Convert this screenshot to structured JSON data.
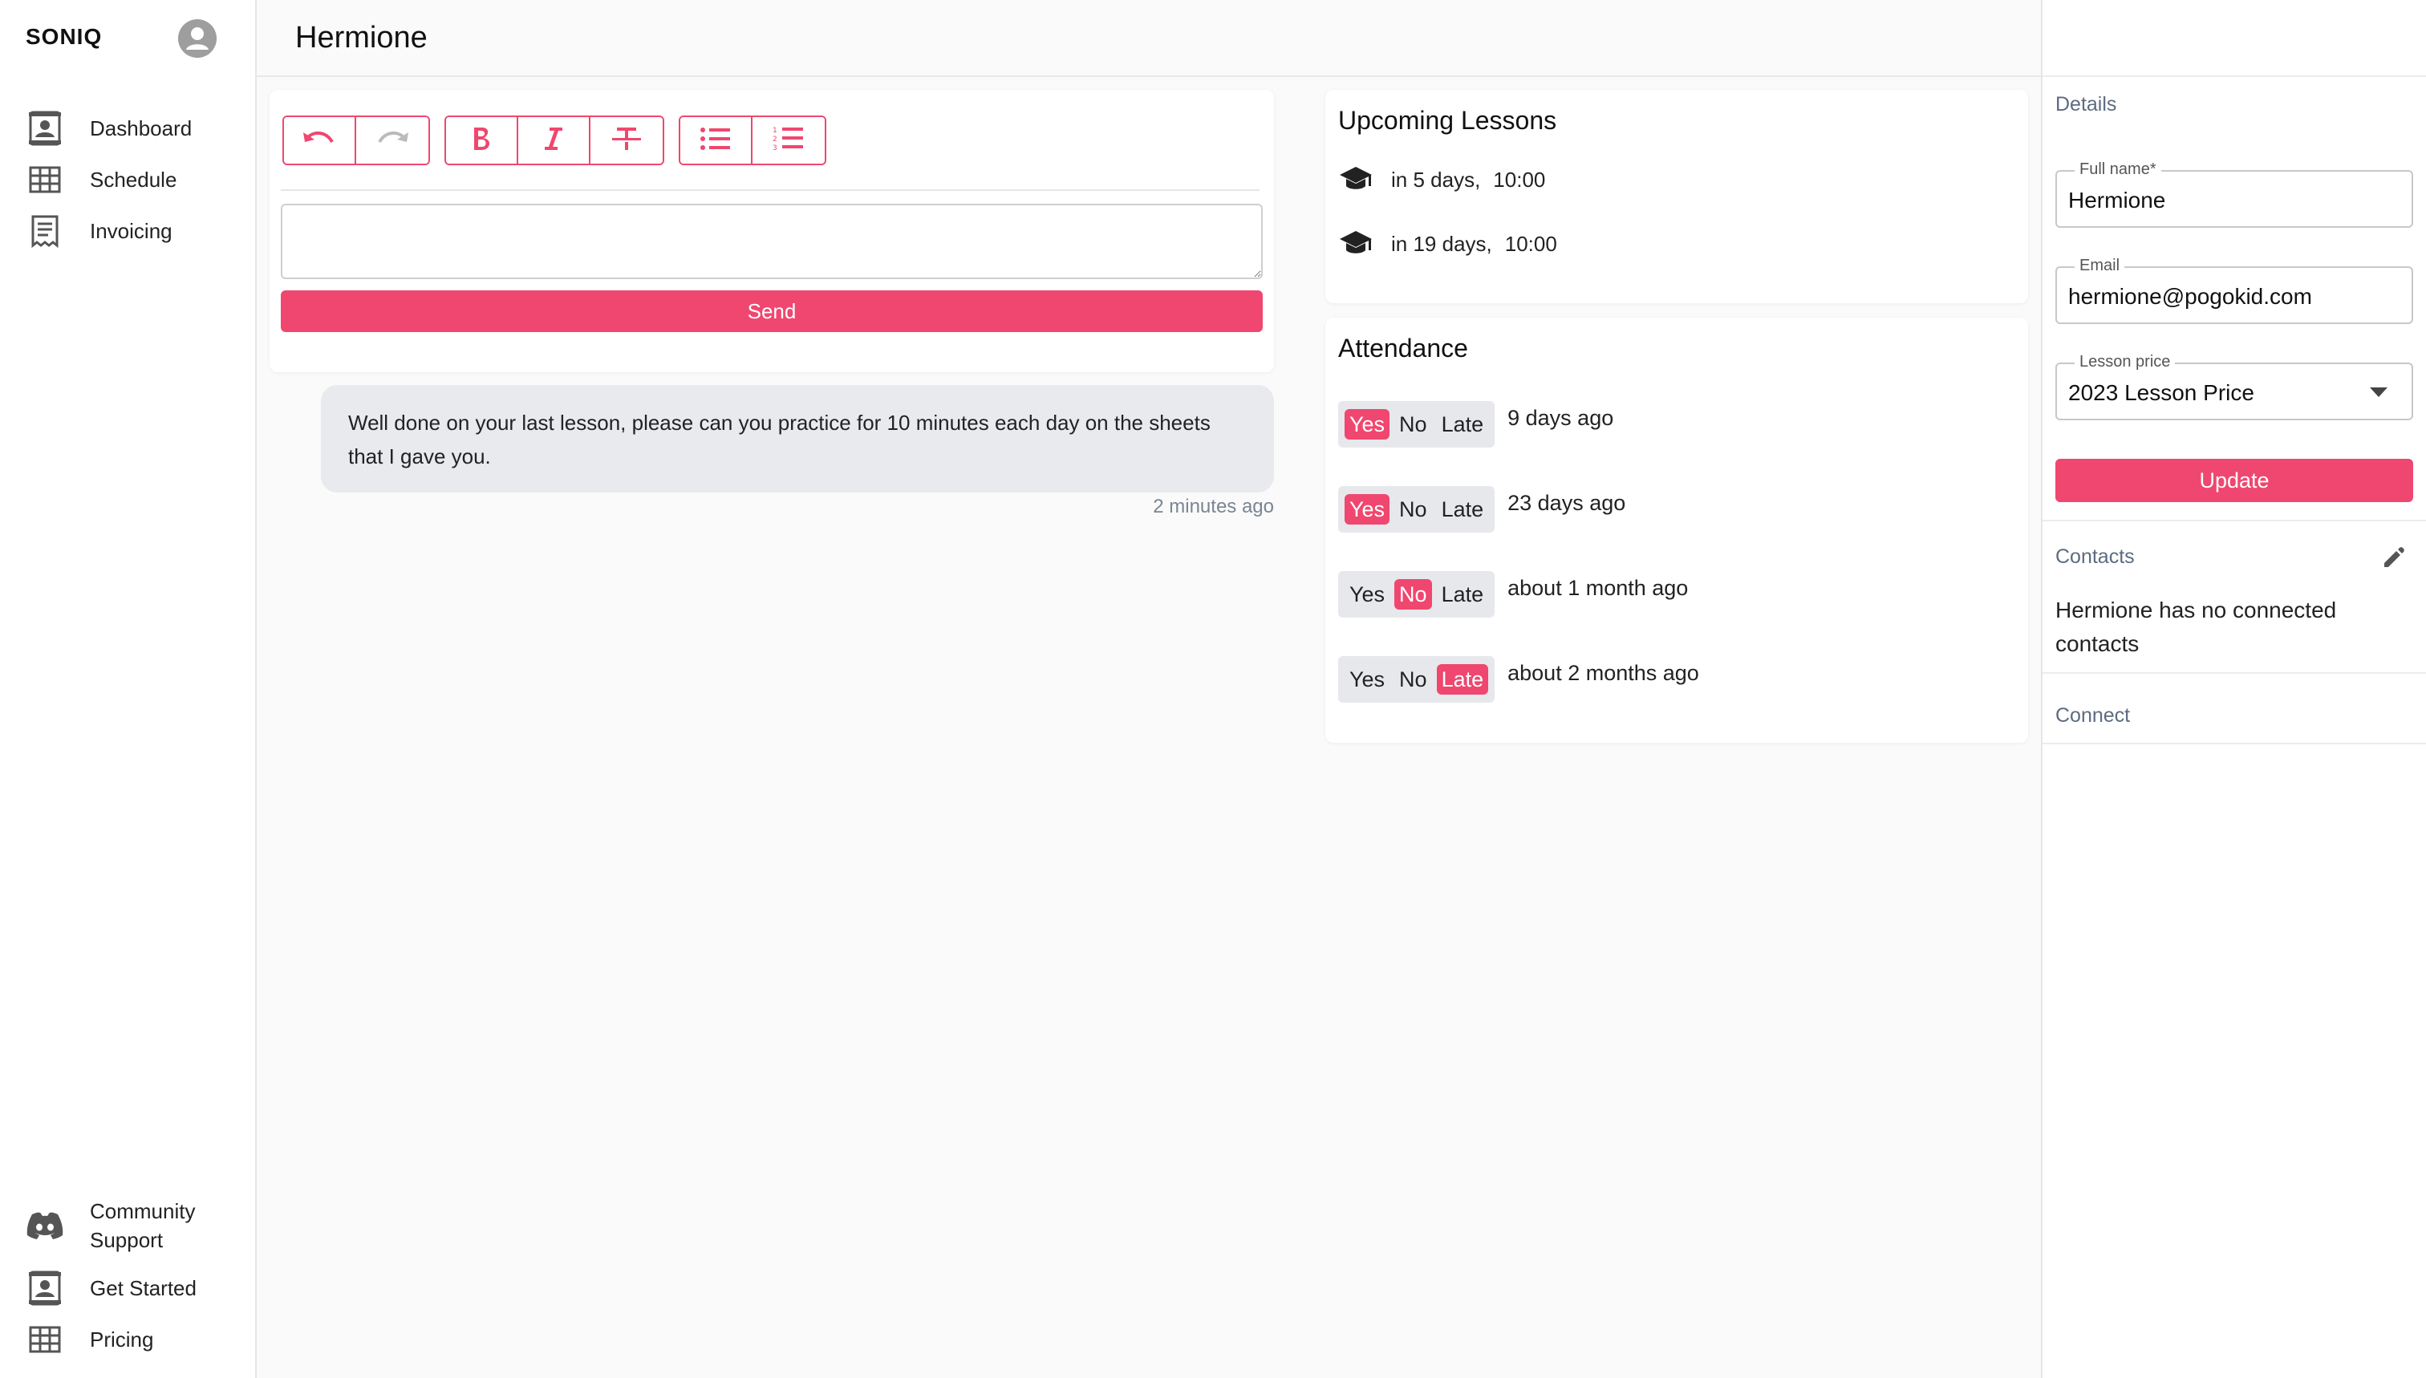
{
  "brand": "SONIQ",
  "sidebar": {
    "items": [
      {
        "label": "Dashboard",
        "icon": "dashboard-icon"
      },
      {
        "label": "Schedule",
        "icon": "grid-icon"
      },
      {
        "label": "Invoicing",
        "icon": "invoice-icon"
      }
    ],
    "bottom_items": [
      {
        "label": "Community Support",
        "icon": "discord-icon"
      },
      {
        "label": "Get Started",
        "icon": "contact-card-icon"
      },
      {
        "label": "Pricing",
        "icon": "grid-icon"
      }
    ]
  },
  "header": {
    "title": "Hermione"
  },
  "editor": {
    "toolbar": [
      "undo-icon",
      "redo-icon",
      "bold-icon",
      "italic-icon",
      "strikethrough-icon",
      "bullet-list-icon",
      "numbered-list-icon"
    ],
    "send_label": "Send"
  },
  "message": {
    "text": "Well done on your last lesson, please can you practice for 10 minutes each day on the sheets that I gave you.",
    "time": "2 minutes ago"
  },
  "upcoming": {
    "title": "Upcoming Lessons",
    "lessons": [
      {
        "when": "in 5 days,",
        "time": "10:00"
      },
      {
        "when": "in 19 days,",
        "time": "10:00"
      }
    ]
  },
  "attendance": {
    "title": "Attendance",
    "options": [
      "Yes",
      "No",
      "Late"
    ],
    "rows": [
      {
        "selected": "Yes",
        "when": "9 days ago"
      },
      {
        "selected": "Yes",
        "when": "23 days ago"
      },
      {
        "selected": "No",
        "when": "about 1 month ago"
      },
      {
        "selected": "Late",
        "when": "about 2 months ago"
      }
    ]
  },
  "details": {
    "title": "Details",
    "full_name_label": "Full name*",
    "full_name": "Hermione",
    "email_label": "Email",
    "email": "hermione@pogokid.com",
    "price_label": "Lesson price",
    "price": "2023 Lesson Price",
    "update_label": "Update"
  },
  "contacts": {
    "title": "Contacts",
    "empty_text": "Hermione has no connected contacts"
  },
  "connect": {
    "title": "Connect"
  },
  "colors": {
    "accent": "#ef476f",
    "muted_text": "#5c6b80",
    "bubble": "#e8eaee"
  }
}
